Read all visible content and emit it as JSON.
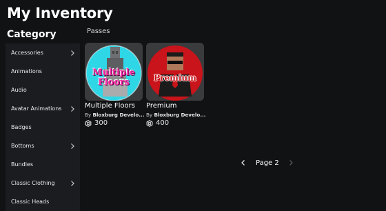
{
  "page": {
    "title": "My Inventory"
  },
  "sidebar": {
    "heading": "Category",
    "items": [
      {
        "label": "Accessories",
        "has_submenu": true
      },
      {
        "label": "Animations",
        "has_submenu": false
      },
      {
        "label": "Audio",
        "has_submenu": false
      },
      {
        "label": "Avatar Animations",
        "has_submenu": true
      },
      {
        "label": "Badges",
        "has_submenu": false
      },
      {
        "label": "Bottoms",
        "has_submenu": true
      },
      {
        "label": "Bundles",
        "has_submenu": false
      },
      {
        "label": "Classic Clothing",
        "has_submenu": true
      },
      {
        "label": "Classic Heads",
        "has_submenu": false
      }
    ]
  },
  "main": {
    "section_label": "Passes",
    "items": [
      {
        "name": "Multiple Floors",
        "thumb_text_line1": "Multiple",
        "thumb_text_line2": "Floors",
        "creator_prefix": "By",
        "creator_name": "Bloxburg Develo...",
        "price": "300"
      },
      {
        "name": "Premium",
        "thumb_text": "Premium",
        "creator_prefix": "By",
        "creator_name": "Bloxburg Develo...",
        "price": "400"
      }
    ],
    "pagination": {
      "label": "Page 2"
    }
  },
  "colors": {
    "background": "#111214",
    "sidebar": "#1b1c1f",
    "card_thumb": "#393b3d",
    "multiple_floors_circle": "#2fd6e6",
    "multiple_floors_text": "#ff2fa8",
    "premium_circle": "#c8141a"
  },
  "icons": {
    "submenu": "chevron-right-icon",
    "price": "robux-icon",
    "pager_prev": "chevron-left-icon",
    "pager_next": "chevron-right-icon"
  }
}
